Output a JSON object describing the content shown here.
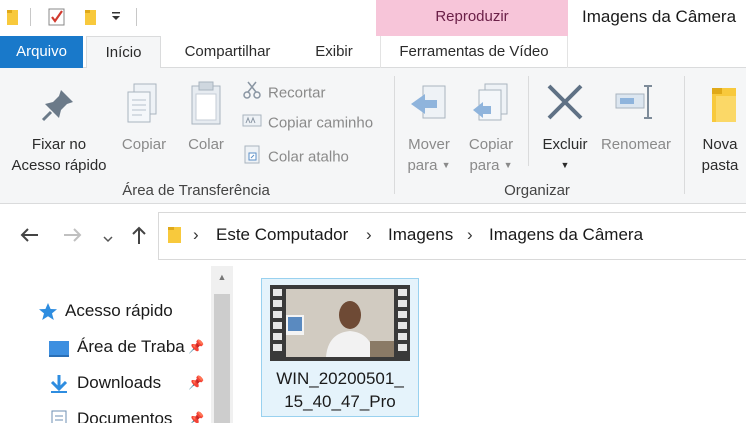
{
  "title_bar": {
    "context_tab": "Reproduzir",
    "window_title": "Imagens da Câmera"
  },
  "tabs": {
    "file": "Arquivo",
    "home": "Início",
    "share": "Compartilhar",
    "view": "Exibir",
    "video_tools": "Ferramentas de Vídeo"
  },
  "ribbon": {
    "clipboard": {
      "pin_line1": "Fixar no",
      "pin_line2": "Acesso rápido",
      "copy": "Copiar",
      "paste": "Colar",
      "cut": "Recortar",
      "copy_path": "Copiar caminho",
      "paste_shortcut": "Colar atalho",
      "group_label": "Área de Transferência"
    },
    "organize": {
      "move_line1": "Mover",
      "move_line2": "para",
      "copy_line1": "Copiar",
      "copy_line2": "para",
      "delete": "Excluir",
      "rename": "Renomear",
      "group_label": "Organizar"
    },
    "new": {
      "new_folder_line1": "Nova",
      "new_folder_line2": "pasta"
    }
  },
  "address": {
    "crumbs": [
      "Este Computador",
      "Imagens",
      "Imagens da Câmera"
    ]
  },
  "nav_pane": {
    "items": [
      "Acesso rápido",
      "Área de Traba",
      "Downloads",
      "Documentos"
    ]
  },
  "files": [
    {
      "name_line1": "WIN_20200501_",
      "name_line2": "15_40_47_Pro"
    }
  ],
  "colors": {
    "file_tab": "#1979ca",
    "context_tab": "#f7c5d9",
    "selection": "#e5f3fb",
    "selection_border": "#99d1ef"
  }
}
